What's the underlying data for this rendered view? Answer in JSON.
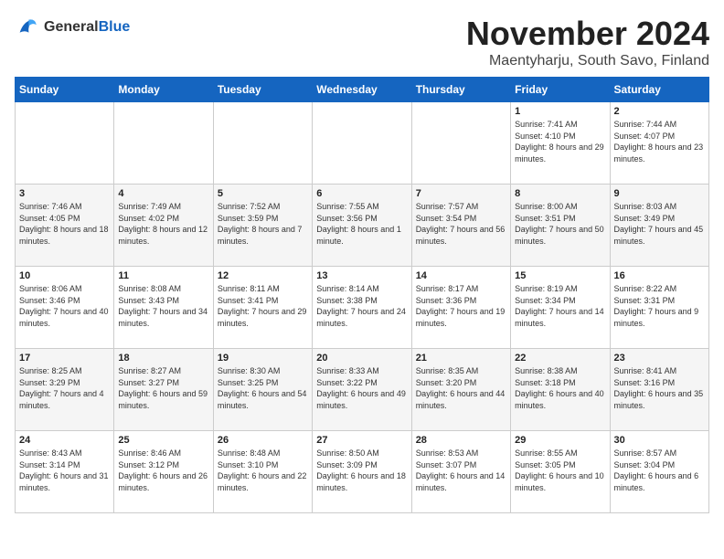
{
  "logo": {
    "general": "General",
    "blue": "Blue"
  },
  "header": {
    "month": "November 2024",
    "location": "Maentyharju, South Savo, Finland"
  },
  "weekdays": [
    "Sunday",
    "Monday",
    "Tuesday",
    "Wednesday",
    "Thursday",
    "Friday",
    "Saturday"
  ],
  "weeks": [
    [
      {
        "day": "",
        "info": ""
      },
      {
        "day": "",
        "info": ""
      },
      {
        "day": "",
        "info": ""
      },
      {
        "day": "",
        "info": ""
      },
      {
        "day": "",
        "info": ""
      },
      {
        "day": "1",
        "info": "Sunrise: 7:41 AM\nSunset: 4:10 PM\nDaylight: 8 hours and 29 minutes."
      },
      {
        "day": "2",
        "info": "Sunrise: 7:44 AM\nSunset: 4:07 PM\nDaylight: 8 hours and 23 minutes."
      }
    ],
    [
      {
        "day": "3",
        "info": "Sunrise: 7:46 AM\nSunset: 4:05 PM\nDaylight: 8 hours and 18 minutes."
      },
      {
        "day": "4",
        "info": "Sunrise: 7:49 AM\nSunset: 4:02 PM\nDaylight: 8 hours and 12 minutes."
      },
      {
        "day": "5",
        "info": "Sunrise: 7:52 AM\nSunset: 3:59 PM\nDaylight: 8 hours and 7 minutes."
      },
      {
        "day": "6",
        "info": "Sunrise: 7:55 AM\nSunset: 3:56 PM\nDaylight: 8 hours and 1 minute."
      },
      {
        "day": "7",
        "info": "Sunrise: 7:57 AM\nSunset: 3:54 PM\nDaylight: 7 hours and 56 minutes."
      },
      {
        "day": "8",
        "info": "Sunrise: 8:00 AM\nSunset: 3:51 PM\nDaylight: 7 hours and 50 minutes."
      },
      {
        "day": "9",
        "info": "Sunrise: 8:03 AM\nSunset: 3:49 PM\nDaylight: 7 hours and 45 minutes."
      }
    ],
    [
      {
        "day": "10",
        "info": "Sunrise: 8:06 AM\nSunset: 3:46 PM\nDaylight: 7 hours and 40 minutes."
      },
      {
        "day": "11",
        "info": "Sunrise: 8:08 AM\nSunset: 3:43 PM\nDaylight: 7 hours and 34 minutes."
      },
      {
        "day": "12",
        "info": "Sunrise: 8:11 AM\nSunset: 3:41 PM\nDaylight: 7 hours and 29 minutes."
      },
      {
        "day": "13",
        "info": "Sunrise: 8:14 AM\nSunset: 3:38 PM\nDaylight: 7 hours and 24 minutes."
      },
      {
        "day": "14",
        "info": "Sunrise: 8:17 AM\nSunset: 3:36 PM\nDaylight: 7 hours and 19 minutes."
      },
      {
        "day": "15",
        "info": "Sunrise: 8:19 AM\nSunset: 3:34 PM\nDaylight: 7 hours and 14 minutes."
      },
      {
        "day": "16",
        "info": "Sunrise: 8:22 AM\nSunset: 3:31 PM\nDaylight: 7 hours and 9 minutes."
      }
    ],
    [
      {
        "day": "17",
        "info": "Sunrise: 8:25 AM\nSunset: 3:29 PM\nDaylight: 7 hours and 4 minutes."
      },
      {
        "day": "18",
        "info": "Sunrise: 8:27 AM\nSunset: 3:27 PM\nDaylight: 6 hours and 59 minutes."
      },
      {
        "day": "19",
        "info": "Sunrise: 8:30 AM\nSunset: 3:25 PM\nDaylight: 6 hours and 54 minutes."
      },
      {
        "day": "20",
        "info": "Sunrise: 8:33 AM\nSunset: 3:22 PM\nDaylight: 6 hours and 49 minutes."
      },
      {
        "day": "21",
        "info": "Sunrise: 8:35 AM\nSunset: 3:20 PM\nDaylight: 6 hours and 44 minutes."
      },
      {
        "day": "22",
        "info": "Sunrise: 8:38 AM\nSunset: 3:18 PM\nDaylight: 6 hours and 40 minutes."
      },
      {
        "day": "23",
        "info": "Sunrise: 8:41 AM\nSunset: 3:16 PM\nDaylight: 6 hours and 35 minutes."
      }
    ],
    [
      {
        "day": "24",
        "info": "Sunrise: 8:43 AM\nSunset: 3:14 PM\nDaylight: 6 hours and 31 minutes."
      },
      {
        "day": "25",
        "info": "Sunrise: 8:46 AM\nSunset: 3:12 PM\nDaylight: 6 hours and 26 minutes."
      },
      {
        "day": "26",
        "info": "Sunrise: 8:48 AM\nSunset: 3:10 PM\nDaylight: 6 hours and 22 minutes."
      },
      {
        "day": "27",
        "info": "Sunrise: 8:50 AM\nSunset: 3:09 PM\nDaylight: 6 hours and 18 minutes."
      },
      {
        "day": "28",
        "info": "Sunrise: 8:53 AM\nSunset: 3:07 PM\nDaylight: 6 hours and 14 minutes."
      },
      {
        "day": "29",
        "info": "Sunrise: 8:55 AM\nSunset: 3:05 PM\nDaylight: 6 hours and 10 minutes."
      },
      {
        "day": "30",
        "info": "Sunrise: 8:57 AM\nSunset: 3:04 PM\nDaylight: 6 hours and 6 minutes."
      }
    ]
  ]
}
